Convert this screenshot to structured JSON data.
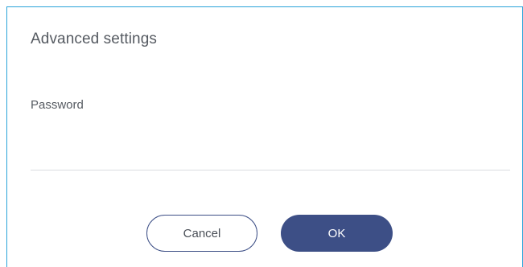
{
  "dialog": {
    "title": "Advanced settings",
    "password_label": "Password",
    "password_value": "",
    "cancel_label": "Cancel",
    "ok_label": "OK"
  },
  "colors": {
    "accent": "#3d4f86",
    "window_border": "#29a3d9",
    "text": "#555a61",
    "divider": "#dadde1"
  }
}
